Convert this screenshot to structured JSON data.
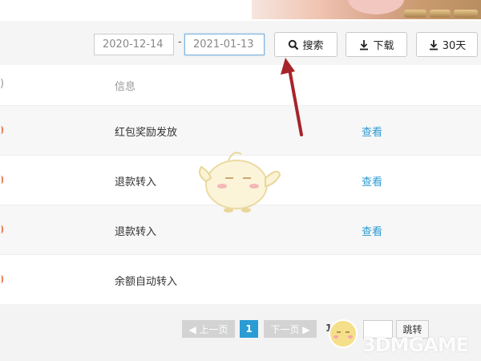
{
  "filter": {
    "start_date": "2020-12-14",
    "end_date": "2021-01-13",
    "separator": "-",
    "search_label": "搜索",
    "download_label": "下载",
    "days_label": "30天"
  },
  "table": {
    "left_header": ")",
    "info_header": "信息",
    "rows": [
      {
        "message": "红包奖励发放",
        "action": "查看"
      },
      {
        "message": "退款转入",
        "action": "查看"
      },
      {
        "message": "退款转入",
        "action": "查看"
      },
      {
        "message": "余额自动转入",
        "action": ""
      }
    ]
  },
  "pagination": {
    "prev_label": "◀ 上一页",
    "current_page": "1",
    "next_label": "下一页 ▶",
    "page_info": "1/",
    "jump_label": "跳转"
  },
  "watermark": "3DMGAME",
  "colors": {
    "link": "#2a9bd3",
    "arrow": "#a6252a",
    "accent_edge": "#e8815d"
  }
}
